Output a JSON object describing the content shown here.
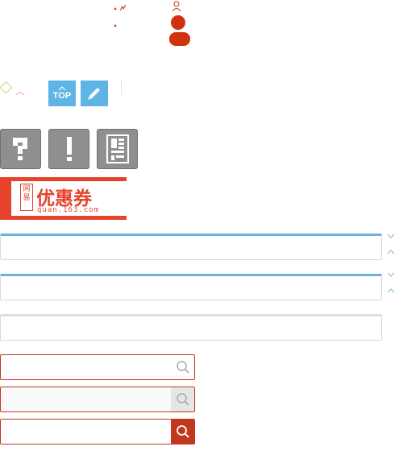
{
  "top_sprites": {
    "user_icon": "user-outline-icon",
    "accent_color": "#d0330f"
  },
  "icons_row": {
    "top_button_label": "TOP",
    "edit_icon": "pencil-icon",
    "blue_color": "#5fb4e6"
  },
  "gray_buttons": [
    {
      "icon": "question-icon"
    },
    {
      "icon": "exclamation-icon"
    },
    {
      "icon": "survey-icon"
    }
  ],
  "coupon": {
    "tag": "网易",
    "title": "优惠券",
    "url": "quan.163.com",
    "color": "#e5432b"
  },
  "text_boxes": [
    {
      "value": "",
      "style": "active"
    },
    {
      "value": "",
      "style": "active"
    },
    {
      "value": "",
      "style": "plain"
    }
  ],
  "search_inputs": [
    {
      "value": "",
      "button_style": "plain"
    },
    {
      "value": "",
      "button_style": "grey"
    },
    {
      "value": "",
      "button_style": "red"
    }
  ],
  "colors": {
    "search_border": "#c0391f",
    "active_border": "#6db3e0"
  }
}
